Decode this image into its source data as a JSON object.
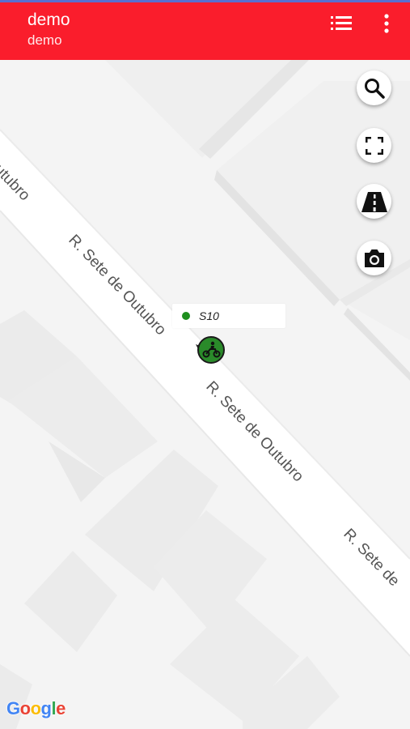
{
  "appbar": {
    "title": "demo",
    "subtitle": "demo",
    "list_icon": "list-icon",
    "more_icon": "more-vert-icon",
    "color": "#fa1d2c"
  },
  "fabs": [
    {
      "icon": "search-icon"
    },
    {
      "icon": "fullscreen-icon"
    },
    {
      "icon": "road-icon"
    },
    {
      "icon": "camera-icon"
    }
  ],
  "map": {
    "street_labels": [
      "utubro",
      "R. Sete de Outubro",
      "R. Sete de Outubro",
      "R. Sete de"
    ]
  },
  "vehicle": {
    "name": "S10",
    "status_color": "#1e8f1e",
    "icon": "motorcycle-icon"
  },
  "attribution": {
    "letters": [
      "G",
      "o",
      "o",
      "g",
      "l",
      "e"
    ],
    "colors": [
      "#4285f4",
      "#ea4335",
      "#fbbc05",
      "#4285f4",
      "#34a853",
      "#ea4335"
    ]
  }
}
